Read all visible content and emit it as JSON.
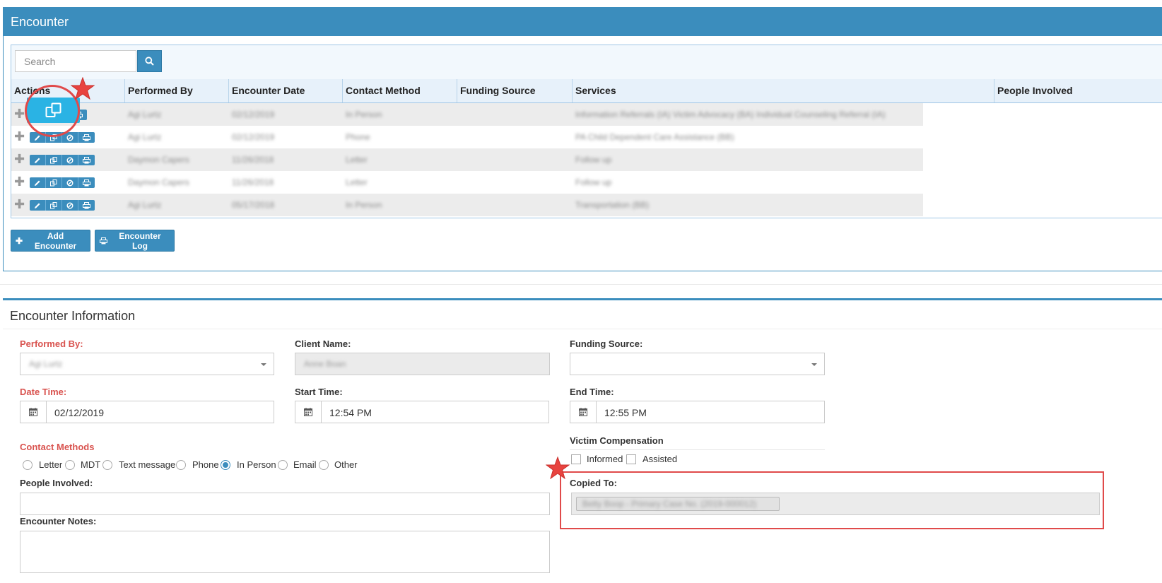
{
  "encounter": {
    "title": "Encounter",
    "search": {
      "placeholder": "Search"
    },
    "columns": [
      "Actions",
      "Performed By",
      "Encounter Date",
      "Contact Method",
      "Funding Source",
      "Services",
      "People Involved"
    ],
    "rows": [
      {
        "performed_by": "Agi Lurtz",
        "date": "02/12/2019",
        "contact": "In Person",
        "services": "Information Referrals (IA) Victim Advocacy (BA) Individual Counseling Referral (IA)"
      },
      {
        "performed_by": "Agi Lurtz",
        "date": "02/12/2019",
        "contact": "Phone",
        "services": "PA Child Dependent Care Assistance (BB)"
      },
      {
        "performed_by": "Daymon Capers",
        "date": "11/26/2018",
        "contact": "Letter",
        "services": "Follow up"
      },
      {
        "performed_by": "Daymon Capers",
        "date": "11/26/2018",
        "contact": "Letter",
        "services": "Follow up"
      },
      {
        "performed_by": "Agi Lurtz",
        "date": "05/17/2018",
        "contact": "In Person",
        "services": "Transportation (BB)"
      }
    ],
    "add_label": "Add Encounter",
    "log_label": "Encounter Log"
  },
  "info": {
    "title": "Encounter Information",
    "performed_by": {
      "label": "Performed By:",
      "value": "Agi Lurtz"
    },
    "client_name": {
      "label": "Client Name:",
      "value": "Anne Boan"
    },
    "funding_source": {
      "label": "Funding Source:"
    },
    "date_time": {
      "label": "Date Time:",
      "value": "02/12/2019"
    },
    "start_time": {
      "label": "Start Time:",
      "value": "12:54 PM"
    },
    "end_time": {
      "label": "End Time:",
      "value": "12:55 PM"
    },
    "contact_methods": {
      "label": "Contact Methods",
      "options": [
        "Letter",
        "MDT",
        "Text message",
        "Phone",
        "In Person",
        "Email",
        "Other"
      ],
      "selected": "In Person"
    },
    "victim_comp": {
      "label": "Victim Compensation",
      "informed": "Informed",
      "assisted": "Assisted"
    },
    "people_involved": {
      "label": "People Involved:"
    },
    "copied_to": {
      "label": "Copied To:",
      "value": "Betty Boop - Primary Case No. (2019-000012)"
    },
    "notes": {
      "label": "Encounter Notes:"
    }
  },
  "colors": {
    "primary": "#3b8dbd",
    "highlight": "#e04a4a",
    "required": "#d9534f",
    "active_button": "#2ab3e4"
  }
}
